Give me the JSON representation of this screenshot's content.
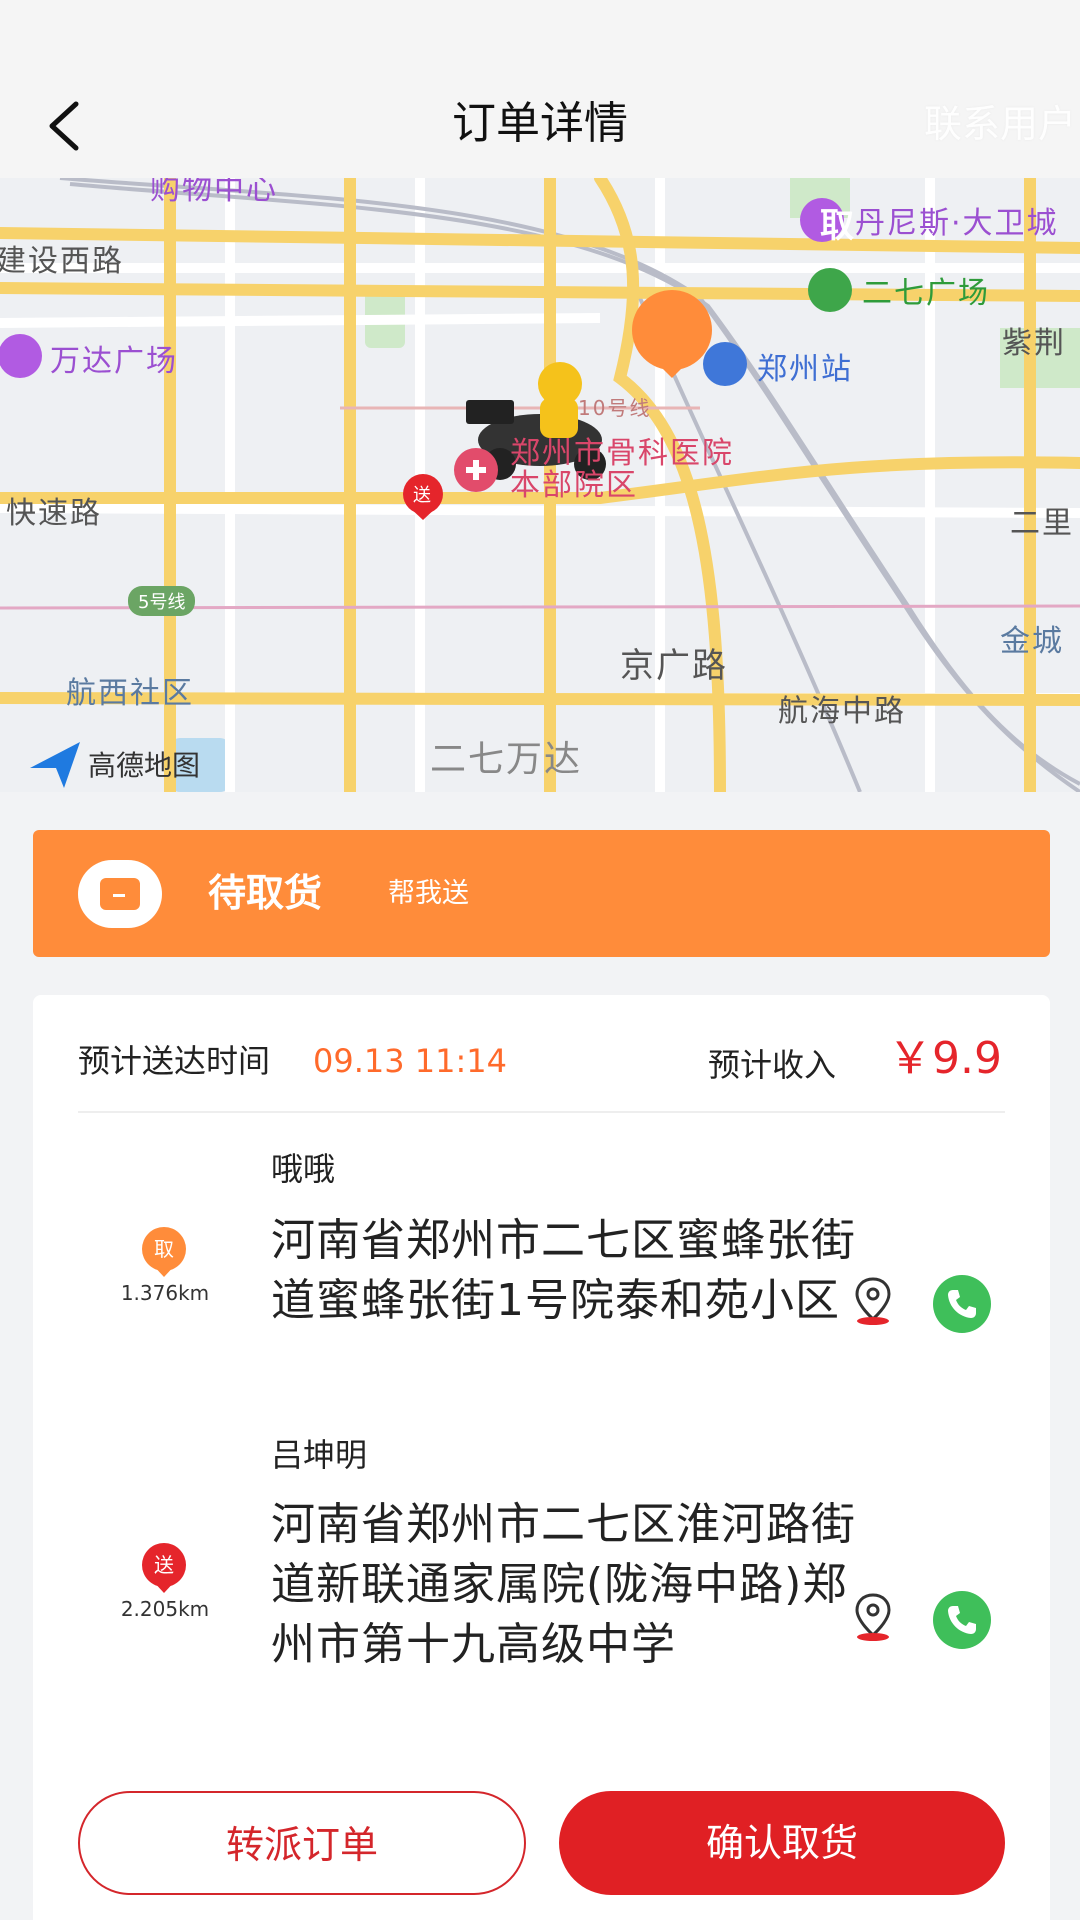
{
  "header": {
    "title": "订单详情",
    "contact_label": "联系用户"
  },
  "map": {
    "pickup_marker": "取",
    "delivery_marker": "送",
    "logo_text": "高德地图",
    "labels": {
      "mall_top": "购物中心",
      "dennis": "丹尼斯·大卫城",
      "erqi_square": "二七广场",
      "jianshe_road": "建设西路",
      "wanda_square": "万达广场",
      "zhengzhou_station": "郑州站",
      "zijing": "紫荆",
      "line10": "10号线",
      "hospital": "郑州市骨科医院本部院区",
      "kuaisu_road": "快速路",
      "erli": "二里",
      "line5": "5号线",
      "jinguang_road": "京广路",
      "jincheng": "金城",
      "hangxi": "航西社区",
      "hanghai_road": "航海中路",
      "erqi_wanda": "二七万达"
    }
  },
  "status": {
    "title": "待取货",
    "subtitle": "帮我送"
  },
  "order": {
    "eta_label": "预计送达时间",
    "eta_value": "09.13 11:14",
    "income_label": "预计收入",
    "income_value": "￥9.9"
  },
  "stops": [
    {
      "marker": "取",
      "distance": "1.376km",
      "name": "哦哦",
      "address": "河南省郑州市二七区蜜蜂张街道蜜蜂张街1号院泰和苑小区"
    },
    {
      "marker": "送",
      "distance": "2.205km",
      "name": "吕坤明",
      "address": "河南省郑州市二七区淮河路街道新联通家属院(陇海中路)郑州市第十九高级中学"
    }
  ],
  "actions": {
    "transfer_label": "转派订单",
    "confirm_label": "确认取货"
  },
  "colors": {
    "accent_orange": "#ff8c3a",
    "accent_red": "#e02024",
    "call_green": "#3fbf5a"
  }
}
